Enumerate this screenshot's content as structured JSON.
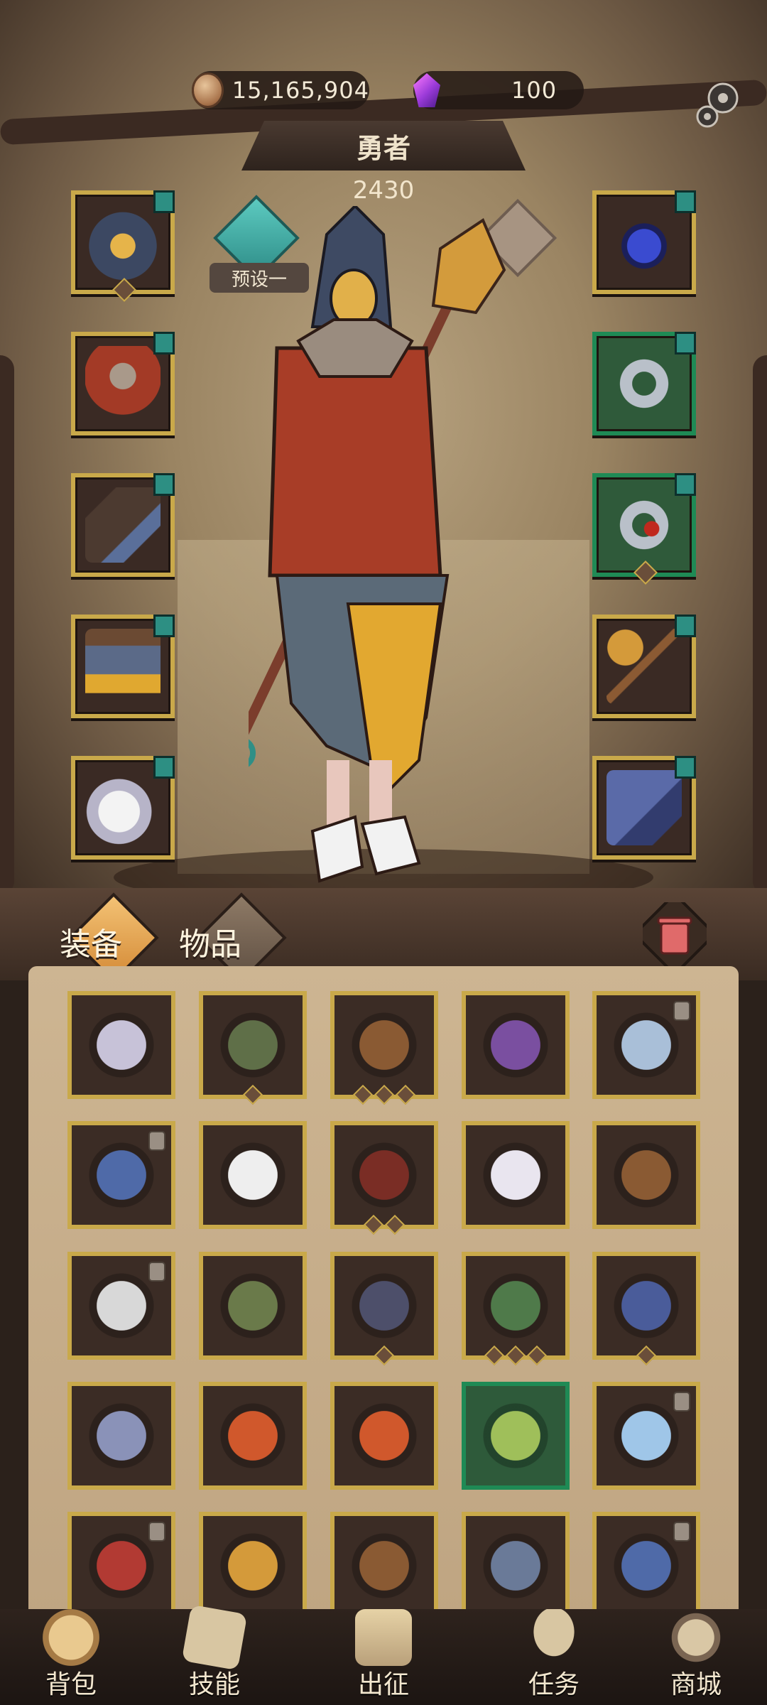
{
  "resources": {
    "gold": "15,165,904",
    "gems": "100"
  },
  "hero": {
    "title": "勇者",
    "power": "2430",
    "preset_label": "预设一"
  },
  "tabs": {
    "equipment": "装备",
    "items": "物品"
  },
  "colors": {
    "slot_gold": "#c9a94a",
    "slot_green": "#1f8a55",
    "tag_teal": "#2d8f83",
    "panel": "#cdb592"
  },
  "equipment": {
    "left": [
      {
        "name": "hood",
        "icon": "hood-icon",
        "rarity": "gold",
        "tagged": true
      },
      {
        "name": "cloak",
        "icon": "cloak-icon",
        "rarity": "gold",
        "tagged": true
      },
      {
        "name": "gloves",
        "icon": "glove-icon",
        "rarity": "gold",
        "tagged": true
      },
      {
        "name": "belt-skirt",
        "icon": "skirt-icon",
        "rarity": "gold",
        "tagged": true
      },
      {
        "name": "boots",
        "icon": "boots-icon",
        "rarity": "gold",
        "tagged": true
      }
    ],
    "right": [
      {
        "name": "heart-necklace",
        "icon": "necklace-icon",
        "rarity": "gold",
        "tagged": true
      },
      {
        "name": "ring-blue",
        "icon": "ring-icon",
        "rarity": "green",
        "tagged": true
      },
      {
        "name": "ring-red",
        "icon": "ring-icon",
        "rarity": "green",
        "tagged": true
      },
      {
        "name": "staff",
        "icon": "staff-icon",
        "rarity": "gold",
        "tagged": true
      },
      {
        "name": "tome",
        "icon": "book-icon",
        "rarity": "gold",
        "tagged": true
      }
    ]
  },
  "inventory": [
    {
      "icon": "fur-coat-icon",
      "rarity": "gold",
      "locked": false,
      "pips": 0
    },
    {
      "icon": "leaf-armor-icon",
      "rarity": "gold",
      "locked": false,
      "pips": 1
    },
    {
      "icon": "spear-icon",
      "rarity": "gold",
      "locked": false,
      "pips": 3
    },
    {
      "icon": "purple-staff-icon",
      "rarity": "gold",
      "locked": false,
      "pips": 0
    },
    {
      "icon": "robe-icon",
      "rarity": "gold",
      "locked": true,
      "pips": 0
    },
    {
      "icon": "book-icon",
      "rarity": "gold",
      "locked": true,
      "pips": 0
    },
    {
      "icon": "boots-icon",
      "rarity": "gold",
      "locked": false,
      "pips": 0
    },
    {
      "icon": "hood-mask-icon",
      "rarity": "gold",
      "locked": false,
      "pips": 2
    },
    {
      "icon": "flower-dress-icon",
      "rarity": "gold",
      "locked": false,
      "pips": 0
    },
    {
      "icon": "spear-icon",
      "rarity": "gold",
      "locked": false,
      "pips": 0
    },
    {
      "icon": "feather-armor-icon",
      "rarity": "gold",
      "locked": true,
      "pips": 0
    },
    {
      "icon": "thin-staff-icon",
      "rarity": "gold",
      "locked": false,
      "pips": 0
    },
    {
      "icon": "gauntlet-icon",
      "rarity": "gold",
      "locked": false,
      "pips": 1
    },
    {
      "icon": "green-staff-icon",
      "rarity": "gold",
      "locked": false,
      "pips": 3
    },
    {
      "icon": "blue-boots-icon",
      "rarity": "gold",
      "locked": false,
      "pips": 1
    },
    {
      "icon": "mace-staff-icon",
      "rarity": "gold",
      "locked": false,
      "pips": 0
    },
    {
      "icon": "fire-book-icon",
      "rarity": "gold",
      "locked": false,
      "pips": 0
    },
    {
      "icon": "fire-book-icon",
      "rarity": "gold",
      "locked": false,
      "pips": 0
    },
    {
      "icon": "green-armor-icon",
      "rarity": "green",
      "locked": false,
      "pips": 0
    },
    {
      "icon": "ice-boots-icon",
      "rarity": "gold",
      "locked": true,
      "pips": 0
    },
    {
      "icon": "red-armor-icon",
      "rarity": "gold",
      "locked": true,
      "pips": 0
    },
    {
      "icon": "staff-icon",
      "rarity": "gold",
      "locked": false,
      "pips": 0
    },
    {
      "icon": "spear-icon",
      "rarity": "gold",
      "locked": false,
      "pips": 0
    },
    {
      "icon": "skirt-icon",
      "rarity": "gold",
      "locked": false,
      "pips": 0
    },
    {
      "icon": "book-icon",
      "rarity": "gold",
      "locked": true,
      "pips": 0
    }
  ],
  "nav": [
    {
      "label": "背包",
      "icon": "backpack-icon"
    },
    {
      "label": "技能",
      "icon": "skill-icon"
    },
    {
      "label": "出征",
      "icon": "expedition-icon"
    },
    {
      "label": "任务",
      "icon": "quest-icon"
    },
    {
      "label": "商城",
      "icon": "shop-icon"
    }
  ]
}
